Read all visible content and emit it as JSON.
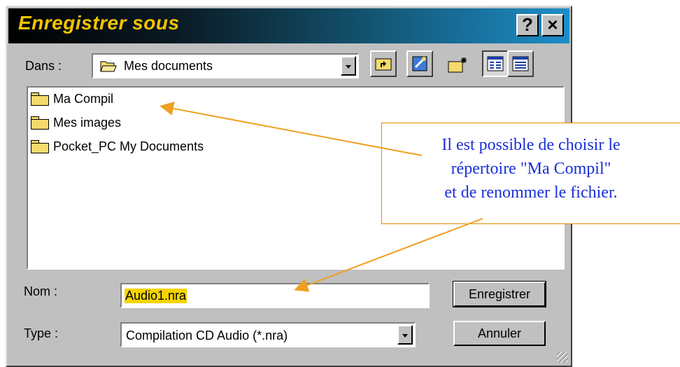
{
  "title": "Enregistrer sous",
  "title_buttons": {
    "help": "?",
    "close": "×"
  },
  "dans": {
    "label": "Dans :",
    "value": "Mes documents"
  },
  "toolbar": [
    "up-folder-icon",
    "desktop-icon",
    "new-folder-icon",
    "list-view-icon",
    "details-view-icon"
  ],
  "files": [
    {
      "name": "Ma Compil"
    },
    {
      "name": "Mes images"
    },
    {
      "name": "Pocket_PC My Documents"
    }
  ],
  "nom": {
    "label": "Nom :",
    "value": "Audio1.nra"
  },
  "type": {
    "label": "Type :",
    "value": "Compilation CD Audio (*.nra)"
  },
  "buttons": {
    "save": "Enregistrer",
    "cancel": "Annuler"
  },
  "callout": {
    "line1": "Il est possible de choisir le",
    "line2": "répertoire \"Ma Compil\"",
    "line3": "et de renommer le fichier."
  },
  "colors": {
    "title_text": "#f4c400",
    "callout_text": "#1a2fd8",
    "arrow": "#f0a020"
  }
}
